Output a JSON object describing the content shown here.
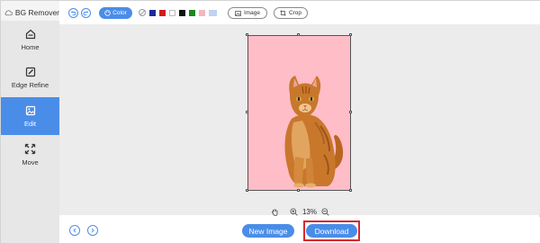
{
  "app": {
    "title": "BG Remover"
  },
  "sidebar": {
    "items": [
      {
        "label": "Home",
        "icon": "home-icon"
      },
      {
        "label": "Edge Refine",
        "icon": "edge-refine-icon"
      },
      {
        "label": "Edit",
        "icon": "edit-image-icon",
        "active": true
      },
      {
        "label": "Move",
        "icon": "move-icon"
      }
    ]
  },
  "toolbar": {
    "color_label": "Color",
    "image_label": "Image",
    "crop_label": "Crop",
    "swatches": [
      "#1a2a9a",
      "#d11a1a",
      "#ffffff",
      "#111111",
      "#1a8a1a",
      "#f2b6c0",
      "#bcd4f2"
    ]
  },
  "zoom": {
    "level": "13%"
  },
  "footer": {
    "new_image_label": "New Image",
    "download_label": "Download"
  },
  "colors": {
    "accent": "#4a8de9",
    "canvas_background": "#ffbdc8",
    "highlight": "#d9272e"
  }
}
